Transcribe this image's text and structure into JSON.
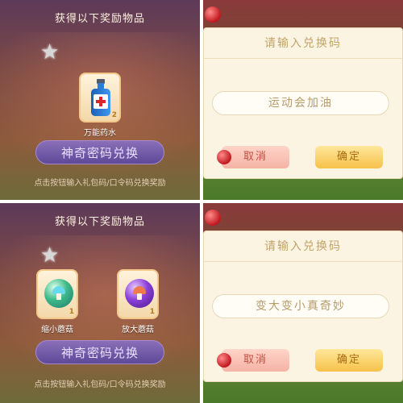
{
  "panels": [
    {
      "reward_title": "获得以下奖励物品",
      "items": [
        {
          "name": "万能药水",
          "count": "2",
          "icon": "potion-icon"
        }
      ],
      "secret_button": "神奇密码兑换",
      "hint": "点击按钮输入礼包码/口令码兑换奖励"
    },
    {
      "dialog_title": "请输入兑换码",
      "code_value": "运动会加油",
      "cancel_label": "取消",
      "confirm_label": "确定"
    },
    {
      "reward_title": "获得以下奖励物品",
      "items": [
        {
          "name": "缩小蘑菇",
          "count": "1",
          "icon": "green-mushroom-icon"
        },
        {
          "name": "放大蘑菇",
          "count": "1",
          "icon": "purple-mushroom-icon"
        }
      ],
      "secret_button": "神奇密码兑换",
      "hint": "点击按钮输入礼包码/口令码兑换奖励"
    },
    {
      "dialog_title": "请输入兑换码",
      "code_value": "变大变小真奇妙",
      "cancel_label": "取消",
      "confirm_label": "确定"
    }
  ],
  "colors": {
    "dialog_bg": "#fbf4e2",
    "title_text": "#c3a36a",
    "cancel_bg": "#f4b3a5",
    "confirm_bg": "#f6c24a",
    "secret_btn_bg": "#5e4a98"
  }
}
